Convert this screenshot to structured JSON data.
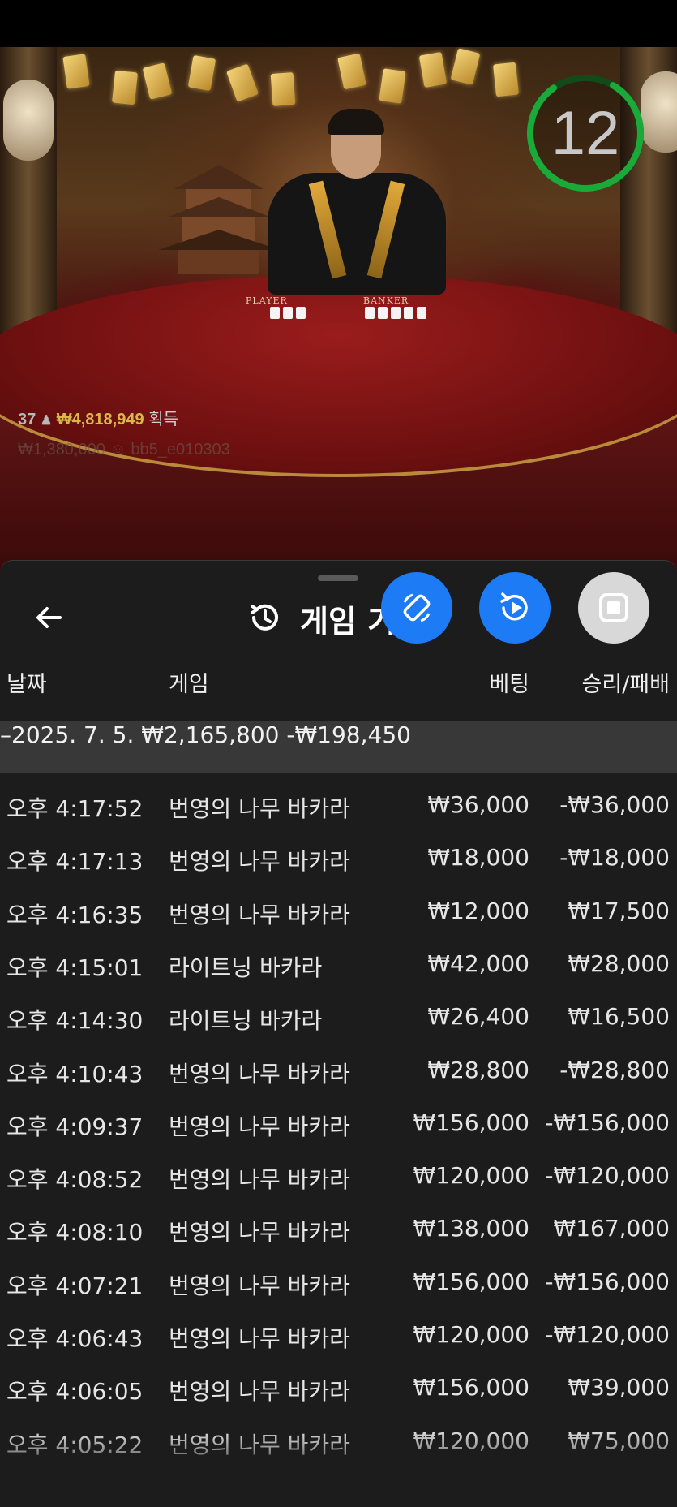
{
  "video": {
    "timer_value": "12",
    "win_info": {
      "count": "37",
      "amount": "₩4,818,949",
      "label": "획득"
    },
    "win_info_secondary": "₩1,380,000 ☺ bb5_e010303",
    "table_labels": {
      "player": "PLAYER",
      "banker": "BANKER"
    }
  },
  "panel": {
    "title": "게임 기",
    "back_icon": "arrow-left-icon",
    "history_icon": "history-icon",
    "buttons": [
      {
        "name": "rotate-screen-button",
        "icon": "rotate-icon",
        "color": "#1d7bf5"
      },
      {
        "name": "replay-video-button",
        "icon": "replay-icon",
        "color": "#1d7bf5"
      },
      {
        "name": "stop-button",
        "icon": "stop-icon",
        "color": "#d8d8d8"
      }
    ],
    "columns": {
      "date": "날짜",
      "game": "게임",
      "bet": "베팅",
      "result": "승리/패배"
    },
    "summary": {
      "date": "–2025. 7. 5.",
      "bet": "₩2,165,800",
      "result": "-₩198,450"
    },
    "rows": [
      {
        "time": "오후 4:17:52",
        "game": "번영의 나무 바카라",
        "bet": "₩36,000",
        "result": "-₩36,000"
      },
      {
        "time": "오후 4:17:13",
        "game": "번영의 나무 바카라",
        "bet": "₩18,000",
        "result": "-₩18,000"
      },
      {
        "time": "오후 4:16:35",
        "game": "번영의 나무 바카라",
        "bet": "₩12,000",
        "result": "₩17,500"
      },
      {
        "time": "오후 4:15:01",
        "game": "라이트닝 바카라",
        "bet": "₩42,000",
        "result": "₩28,000"
      },
      {
        "time": "오후 4:14:30",
        "game": "라이트닝 바카라",
        "bet": "₩26,400",
        "result": "₩16,500"
      },
      {
        "time": "오후 4:10:43",
        "game": "번영의 나무 바카라",
        "bet": "₩28,800",
        "result": "-₩28,800"
      },
      {
        "time": "오후 4:09:37",
        "game": "번영의 나무 바카라",
        "bet": "₩156,000",
        "result": "-₩156,000"
      },
      {
        "time": "오후 4:08:52",
        "game": "번영의 나무 바카라",
        "bet": "₩120,000",
        "result": "-₩120,000"
      },
      {
        "time": "오후 4:08:10",
        "game": "번영의 나무 바카라",
        "bet": "₩138,000",
        "result": "₩167,000"
      },
      {
        "time": "오후 4:07:21",
        "game": "번영의 나무 바카라",
        "bet": "₩156,000",
        "result": "-₩156,000"
      },
      {
        "time": "오후 4:06:43",
        "game": "번영의 나무 바카라",
        "bet": "₩120,000",
        "result": "-₩120,000"
      },
      {
        "time": "오후 4:06:05",
        "game": "번영의 나무 바카라",
        "bet": "₩156,000",
        "result": "₩39,000"
      },
      {
        "time": "오후 4:05:22",
        "game": "번영의 나무 바카라",
        "bet": "₩120,000",
        "result": "₩75,000"
      }
    ]
  }
}
